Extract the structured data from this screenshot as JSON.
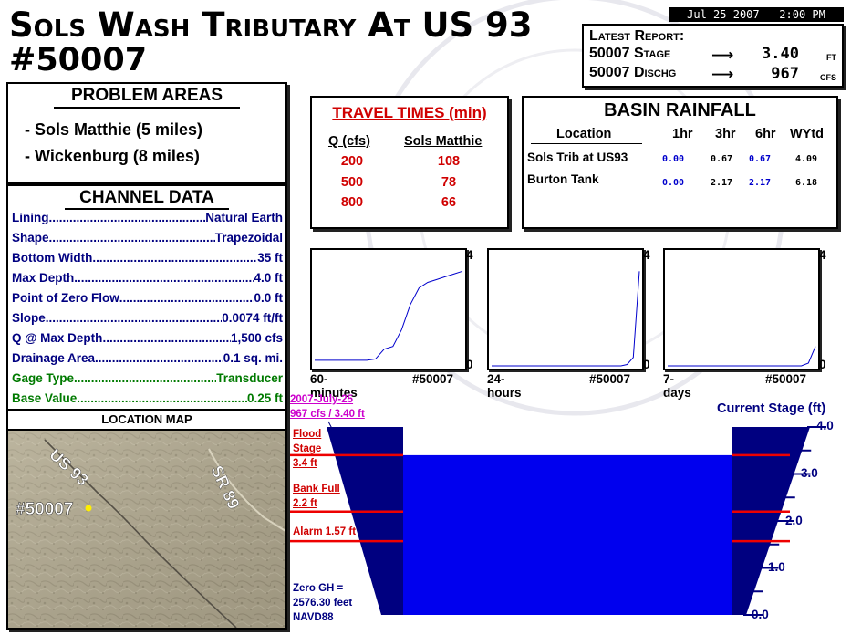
{
  "title": {
    "line1": "Sols Wash Tributary At US 93",
    "line2": "#50007"
  },
  "report_datetime": "Jul 25 2007   2:00 PM",
  "latest": {
    "heading": "Latest Report:",
    "stage_label": "50007 Stage",
    "stage_arrow": "⟶",
    "stage_value": "3.40",
    "stage_unit": "FT",
    "disch_label": "50007 Dischg",
    "disch_arrow": "⟶",
    "disch_value": "967",
    "disch_unit": "CFS"
  },
  "problem_areas": {
    "heading": "PROBLEM AREAS",
    "items": [
      "- Sols Matthie (5 miles)",
      "- Wickenburg (8 miles)"
    ]
  },
  "channel_data": {
    "heading": "CHANNEL DATA",
    "rows": [
      {
        "label": "Lining",
        "value": "Natural Earth"
      },
      {
        "label": "Shape",
        "value": "Trapezoidal"
      },
      {
        "label": "Bottom Width",
        "value": "35 ft"
      },
      {
        "label": "Max Depth",
        "value": "4.0 ft"
      },
      {
        "label": "Point of Zero Flow",
        "value": "0.0 ft"
      },
      {
        "label": "Slope",
        "value": "0.0074 ft/ft"
      },
      {
        "label": "Q @ Max Depth",
        "value": "1,500 cfs"
      },
      {
        "label": "Drainage Area",
        "value": "0.1 sq. mi."
      },
      {
        "label": "Gage Type",
        "value": "Transducer"
      },
      {
        "label": "Base Value",
        "value": "0.25 ft"
      }
    ]
  },
  "location_map": {
    "heading": "LOCATION MAP",
    "road1": "US 93",
    "road2": "SR 89",
    "gage": "#50007"
  },
  "travel_times": {
    "heading": "TRAVEL TIMES (min)",
    "col1": "Q (cfs)",
    "col2": "Sols Matthie",
    "rows": [
      {
        "q": "200",
        "t": "108"
      },
      {
        "q": "500",
        "t": "78"
      },
      {
        "q": "800",
        "t": "66"
      }
    ]
  },
  "basin_rainfall": {
    "heading": "BASIN RAINFALL",
    "cols": [
      "Location",
      "1hr",
      "3hr",
      "6hr",
      "WYtd"
    ],
    "rows": [
      {
        "location": "Sols Trib at US93",
        "v1": "0.00",
        "v3": "0.67",
        "v6": "0.67",
        "wy": "4.09"
      },
      {
        "location": "Burton Tank",
        "v1": "0.00",
        "v3": "2.17",
        "v6": "2.17",
        "wy": "6.18"
      }
    ],
    "colors": {
      "v1": "#0000cc",
      "v3": "#000000",
      "v6": "#0000cc",
      "wy": "#000000"
    }
  },
  "sparklines": [
    {
      "period": "60-minutes",
      "gage": "#50007",
      "ymax": "4",
      "ymin": "0",
      "values": [
        0.2,
        0.2,
        0.2,
        0.2,
        0.2,
        0.2,
        0.2,
        0.25,
        0.6,
        0.7,
        1.3,
        2.2,
        2.8,
        3.0,
        3.1,
        3.2,
        3.3,
        3.4
      ]
    },
    {
      "period": "24-hours",
      "gage": "#50007",
      "ymax": "4",
      "ymin": "0",
      "values": [
        0,
        0,
        0,
        0,
        0,
        0,
        0,
        0,
        0,
        0,
        0,
        0,
        0,
        0,
        0,
        0,
        0,
        0,
        0,
        0,
        0,
        0,
        0.05,
        0.3,
        3.4
      ]
    },
    {
      "period": "7-days",
      "gage": "#50007",
      "ymax": "4",
      "ymin": "0",
      "values": [
        0,
        0,
        0,
        0,
        0,
        0,
        0,
        0,
        0,
        0,
        0,
        0,
        0,
        0,
        0,
        0,
        0,
        0,
        0,
        0,
        0.1,
        0.7
      ]
    }
  ],
  "gauge": {
    "datestamp_line1": "2007-July-25",
    "datestamp_line2": "967 cfs / 3.40 ft",
    "current_stage_label": "Current Stage (ft)",
    "stage": 3.4,
    "max": 4.0,
    "scale_labels": [
      "4.0",
      "3.0",
      "2.0",
      "1.0",
      "0.0"
    ],
    "flood_label": "Flood\nStage\n3.4 ft",
    "flood_value": 3.4,
    "bankfull_label": "Bank Full\n2.2 ft",
    "bankfull_value": 2.2,
    "alarm_label": "Alarm 1.57 ft",
    "alarm_value": 1.57,
    "zero_gh": "Zero GH =\n2576.30 feet\nNAVD88",
    "water_color": "#0000ee",
    "bank_color": "#000080",
    "line_color": "#ee0000"
  }
}
